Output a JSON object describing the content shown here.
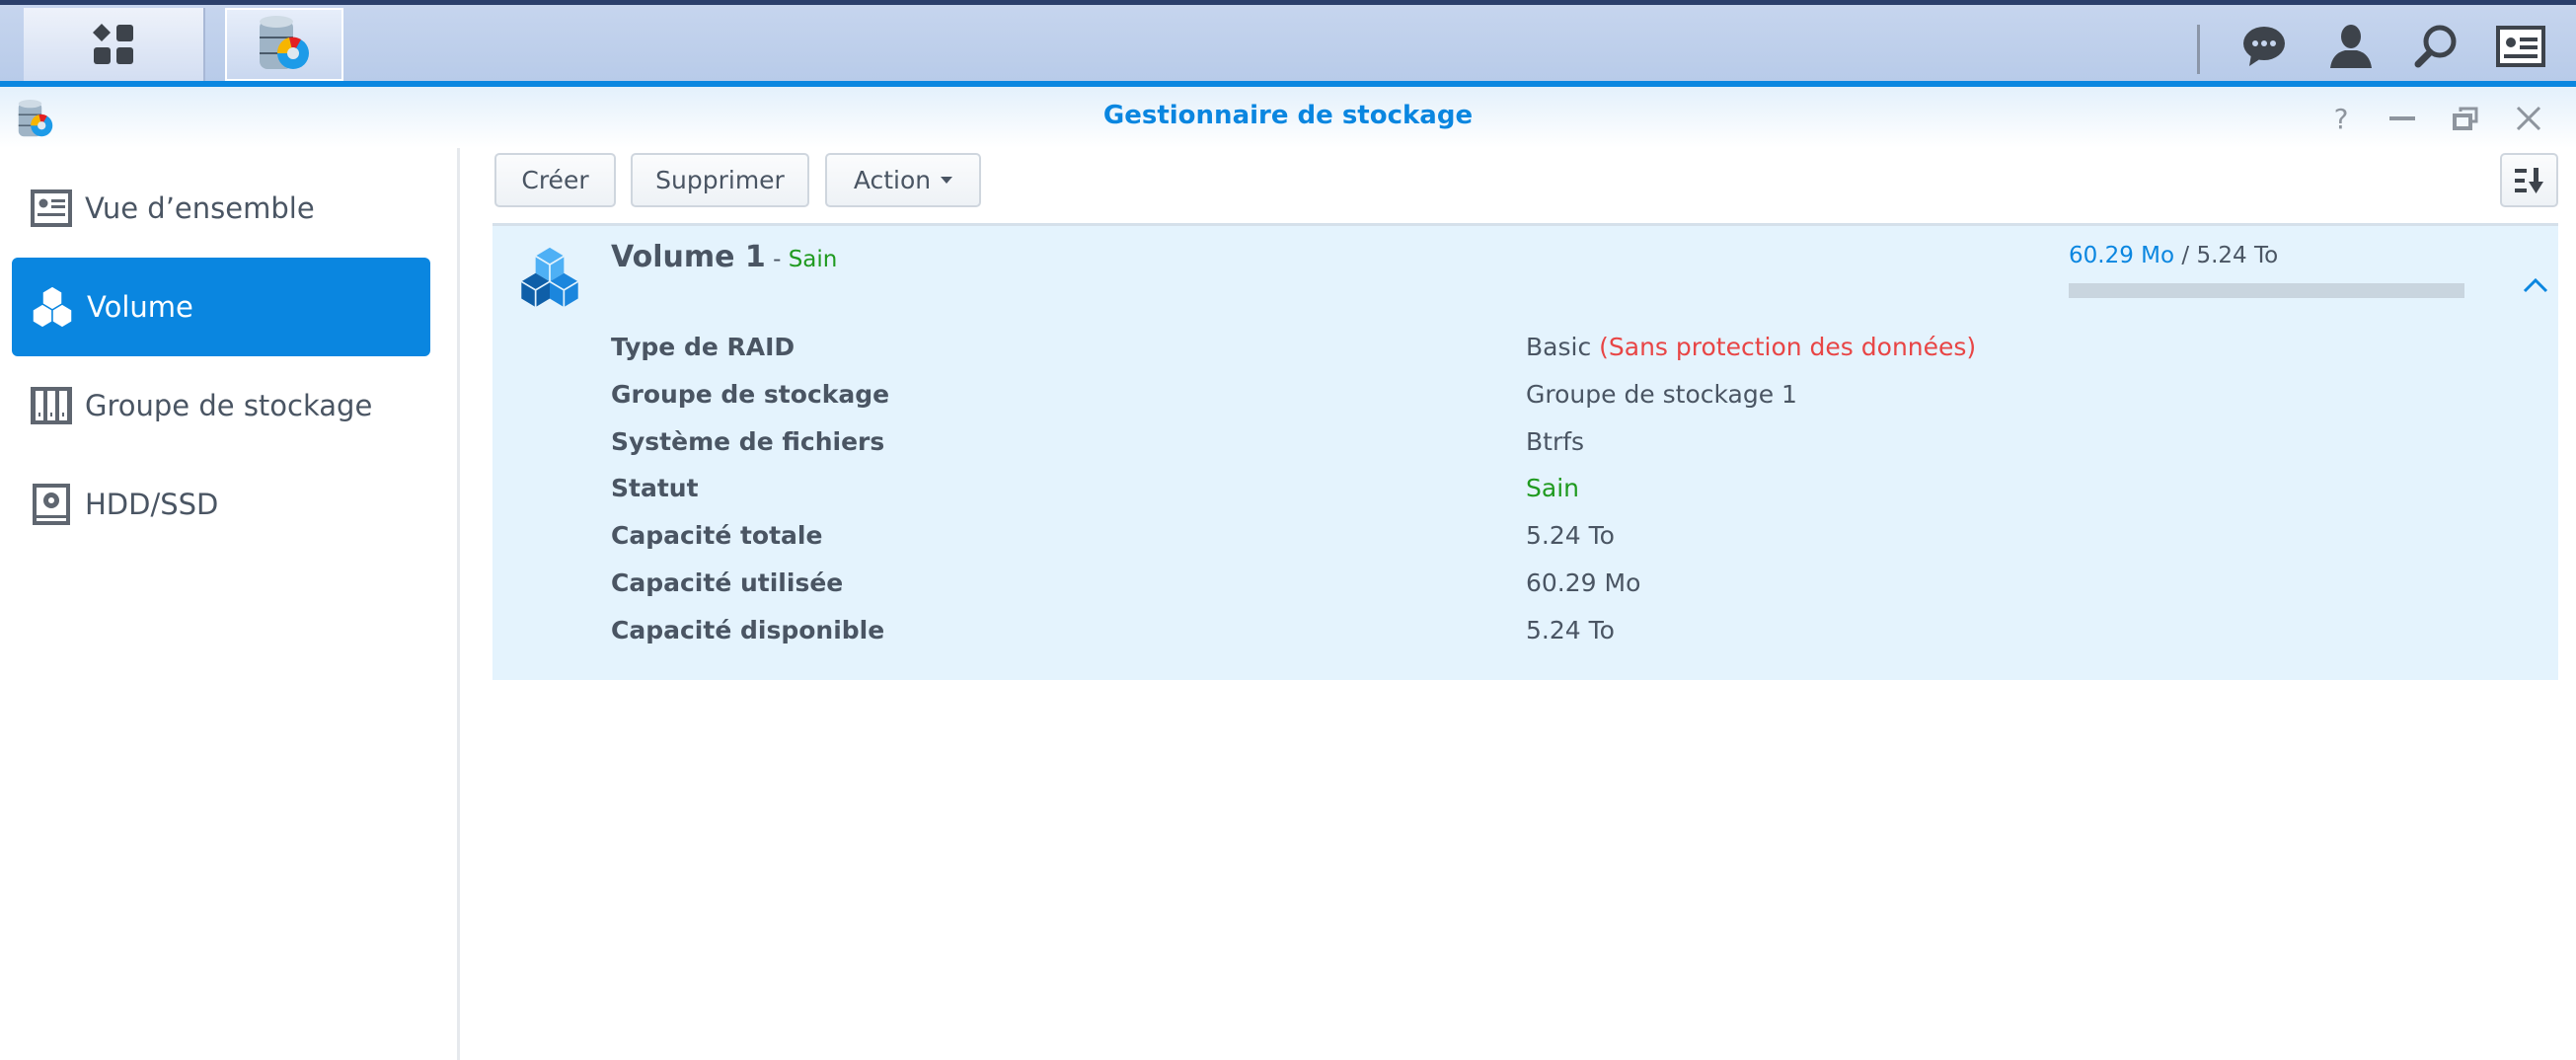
{
  "taskbar": {
    "home_icon": "main-menu-icon",
    "app_icon": "storage-manager-icon",
    "tray": [
      "chat-icon",
      "user-icon",
      "search-icon",
      "widgets-icon"
    ]
  },
  "window": {
    "title": "Gestionnaire de stockage",
    "controls": [
      "help-icon",
      "minimize-icon",
      "restore-icon",
      "close-icon"
    ]
  },
  "sidebar": {
    "items": [
      {
        "label": "Vue d’ensemble",
        "icon": "overview-icon",
        "active": false
      },
      {
        "label": "Volume",
        "icon": "volume-icon",
        "active": true
      },
      {
        "label": "Groupe de stockage",
        "icon": "storage-pool-icon",
        "active": false
      },
      {
        "label": "HDD/SSD",
        "icon": "hdd-icon",
        "active": false
      }
    ]
  },
  "toolbar": {
    "create": "Créer",
    "delete": "Supprimer",
    "action": "Action",
    "sort_icon": "sort-icon"
  },
  "volume": {
    "name": "Volume 1",
    "dash": " - ",
    "status": "Sain",
    "used": "60.29 Mo",
    "separator": " / ",
    "total": "5.24 To",
    "usage_fraction": 1.12e-05,
    "details": [
      {
        "label": "Type de RAID",
        "value": "Basic",
        "extra": "(Sans protection des données)"
      },
      {
        "label": "Groupe de stockage",
        "value": "Groupe de stockage 1"
      },
      {
        "label": "Système de fichiers",
        "value": "Btrfs"
      },
      {
        "label": "Statut",
        "value": "Sain"
      },
      {
        "label": "Capacité totale",
        "value": "5.24 To"
      },
      {
        "label": "Capacité utilisée",
        "value": "60.29 Mo"
      },
      {
        "label": "Capacité disponible",
        "value": "5.24 To"
      }
    ]
  },
  "colors": {
    "accent": "#0a86e0",
    "healthy": "#1f9a1f",
    "warning": "#e84545"
  }
}
